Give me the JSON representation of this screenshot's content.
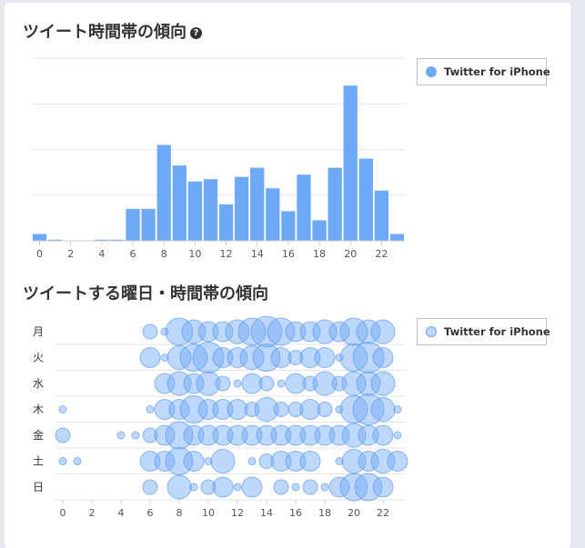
{
  "charts": {
    "hourly": {
      "title": "ツイート時間帯の傾向",
      "help_icon": "question-circle-icon",
      "legend": "Twitter for iPhone"
    },
    "weekday": {
      "title": "ツイートする曜日・時間帯の傾向",
      "legend": "Twitter for iPhone"
    }
  },
  "colors": {
    "bar": "#6ea9f7",
    "bubble_fill": "rgba(110,169,247,0.45)",
    "bubble_stroke": "rgba(90,150,235,0.65)",
    "grid": "#e6e6e6",
    "axis_text": "#555555"
  },
  "chart_data": [
    {
      "type": "bar",
      "series": [
        {
          "name": "Twitter for iPhone",
          "values": [
            3,
            0.5,
            0,
            0,
            0.5,
            0.5,
            14,
            14,
            42,
            33,
            26,
            27,
            16,
            28,
            32,
            23,
            13,
            29,
            9,
            32,
            68,
            36,
            22,
            3
          ]
        }
      ],
      "x": [
        0,
        1,
        2,
        3,
        4,
        5,
        6,
        7,
        8,
        9,
        10,
        11,
        12,
        13,
        14,
        15,
        16,
        17,
        18,
        19,
        20,
        21,
        22,
        23
      ],
      "x_ticks": [
        "0",
        "2",
        "4",
        "6",
        "8",
        "10",
        "12",
        "14",
        "16",
        "18",
        "20",
        "22"
      ],
      "ylim": [
        0,
        80
      ],
      "y_ticks_shown": false,
      "grid": true,
      "legend_position": "top-right"
    },
    {
      "type": "scatter",
      "series_name": "Twitter for iPhone",
      "rows": [
        "月",
        "火",
        "水",
        "木",
        "金",
        "土",
        "日"
      ],
      "x_ticks": [
        "0",
        "2",
        "4",
        "6",
        "8",
        "10",
        "12",
        "14",
        "16",
        "18",
        "20",
        "22"
      ],
      "grid": true,
      "legend_position": "top-right",
      "sizes": [
        [
          0,
          0,
          0,
          0,
          0,
          0,
          2,
          1,
          5,
          4,
          3,
          3,
          4,
          5,
          6,
          5,
          3,
          3,
          4,
          3,
          5,
          4,
          4,
          0
        ],
        [
          0,
          0,
          0,
          0,
          0,
          0,
          3,
          1,
          4,
          5,
          6,
          3,
          3,
          4,
          5,
          3,
          2,
          3,
          3,
          1,
          5,
          6,
          3,
          0
        ],
        [
          0,
          0,
          0,
          0,
          0,
          0,
          0,
          3,
          4,
          3,
          4,
          2,
          1,
          3,
          2,
          1,
          3,
          2,
          4,
          2,
          4,
          4,
          4,
          0
        ],
        [
          1,
          0,
          0,
          0,
          0,
          0,
          1,
          3,
          3,
          5,
          3,
          3,
          3,
          2,
          4,
          2,
          2,
          3,
          2,
          1,
          5,
          6,
          4,
          1
        ],
        [
          2,
          0,
          0,
          0,
          1,
          1,
          2,
          3,
          5,
          3,
          3,
          3,
          3,
          3,
          3,
          3,
          3,
          3,
          3,
          3,
          4,
          3,
          3,
          1
        ],
        [
          1,
          1,
          0,
          0,
          0,
          0,
          3,
          3,
          5,
          3,
          1,
          4,
          0,
          1,
          2,
          3,
          3,
          3,
          0,
          1,
          4,
          3,
          4,
          3
        ],
        [
          0,
          0,
          0,
          0,
          0,
          0,
          2,
          0,
          4,
          1,
          2,
          3,
          1,
          3,
          0,
          2,
          1,
          2,
          1,
          3,
          5,
          5,
          3,
          0
        ]
      ]
    }
  ]
}
